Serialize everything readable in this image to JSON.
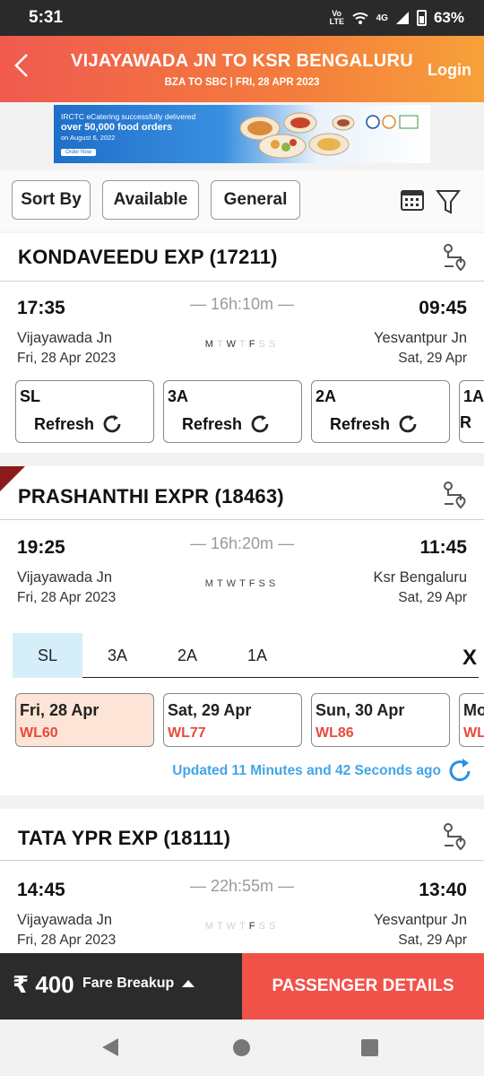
{
  "status_bar": {
    "time": "5:31",
    "volte": "Vo LTE",
    "network": "4G",
    "battery": "63%"
  },
  "header": {
    "title": "VIJAYAWADA JN TO KSR BENGALURU",
    "subtitle": "BZA TO SBC | FRI, 28 APR  2023",
    "login": "Login"
  },
  "banner": {
    "line1": "IRCTC eCatering successfully delivered",
    "line2": "over 50,000 food orders",
    "line3": "on August 6, 2022",
    "cta": "Order Now"
  },
  "filters": {
    "sort": "Sort By",
    "available": "Available",
    "general": "General"
  },
  "icons": {
    "calendar": "calendar-icon",
    "filter": "funnel-icon",
    "route": "route-map-icon",
    "refresh": "refresh-icon",
    "close": "close-icon"
  },
  "trains": [
    {
      "name": "KONDAVEEDU EXP (17211)",
      "dep_time": "17:35",
      "arr_time": "09:45",
      "duration": "— 16h:10m —",
      "from": "Vijayawada Jn",
      "to": "Yesvantpur Jn",
      "dep_date": "Fri, 28 Apr  2023",
      "arr_date": "Sat, 29 Apr",
      "days": [
        "M",
        "T",
        "W",
        "T",
        "F",
        "S",
        "S"
      ],
      "classes": [
        {
          "code": "SL",
          "status": "Refresh"
        },
        {
          "code": "3A",
          "status": "Refresh"
        },
        {
          "code": "2A",
          "status": "Refresh"
        },
        {
          "code": "1A",
          "status": "R"
        }
      ]
    },
    {
      "name": "PRASHANTHI EXPR (18463)",
      "dep_time": "19:25",
      "arr_time": "11:45",
      "duration": "— 16h:20m —",
      "from": "Vijayawada Jn",
      "to": "Ksr Bengaluru",
      "dep_date": "Fri, 28 Apr  2023",
      "arr_date": "Sat, 29 Apr",
      "days": [
        "M",
        "T",
        "W",
        "T",
        "F",
        "S",
        "S"
      ],
      "tabs": [
        "SL",
        "3A",
        "2A",
        "1A"
      ],
      "close": "X",
      "availability": [
        {
          "date": "Fri, 28 Apr",
          "status": "WL60"
        },
        {
          "date": "Sat, 29 Apr",
          "status": "WL77"
        },
        {
          "date": "Sun, 30 Apr",
          "status": "WL86"
        },
        {
          "date": "Mo",
          "status": "WL"
        }
      ],
      "updated": "Updated 11 Minutes and 42 Seconds ago"
    },
    {
      "name": "TATA YPR EXP (18111)",
      "dep_time": "14:45",
      "arr_time": "13:40",
      "duration": "— 22h:55m —",
      "from": "Vijayawada Jn",
      "to": "Yesvantpur Jn",
      "dep_date": "Fri, 28 Apr  2023",
      "arr_date": "Sat, 29 Apr",
      "days": [
        "M",
        "T",
        "W",
        "T",
        "F",
        "S",
        "S"
      ]
    }
  ],
  "bottom": {
    "fare": "₹ 400",
    "fare_breakup": "Fare Breakup",
    "cta": "PASSENGER DETAILS"
  },
  "colors": {
    "accent": "#f0524a",
    "header_start": "#f05a4f",
    "header_end": "#f7a13a",
    "link_blue": "#42a5e8",
    "waitlist_red": "#e84a3c",
    "selected_tab": "#d6eef9",
    "selected_date": "#fce4d6"
  }
}
